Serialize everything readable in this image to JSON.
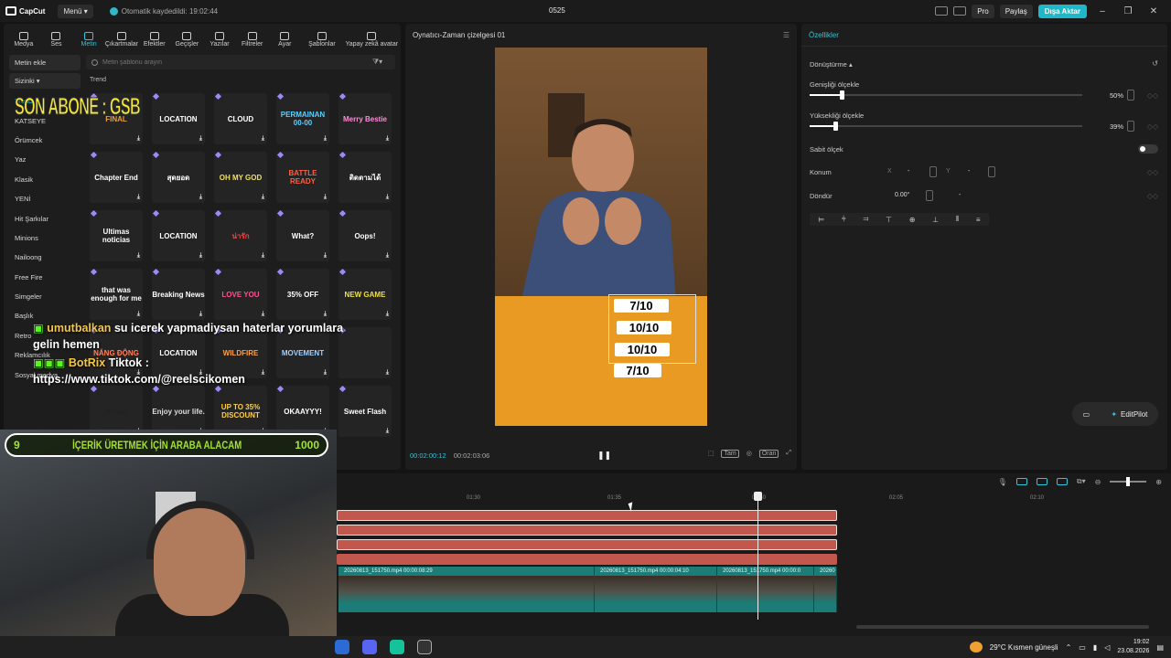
{
  "titlebar": {
    "app_name": "CapCut",
    "menu_label": "Menü",
    "autosave": "Otomatik kaydedildi: 19:02:44",
    "project_name": "0525",
    "pro_label": "Pro",
    "share_label": "Paylaş",
    "export_label": "Dışa Aktar"
  },
  "toolbar": {
    "items": [
      {
        "label": "Medya",
        "icon": "media-icon"
      },
      {
        "label": "Ses",
        "icon": "audio-icon"
      },
      {
        "label": "Metin",
        "icon": "text-icon"
      },
      {
        "label": "Çıkartmalar",
        "icon": "sticker-icon"
      },
      {
        "label": "Efektler",
        "icon": "effects-icon"
      },
      {
        "label": "Geçişler",
        "icon": "transition-icon"
      },
      {
        "label": "Yazılar",
        "icon": "captions-icon"
      },
      {
        "label": "Filtreler",
        "icon": "filter-icon"
      },
      {
        "label": "Ayar",
        "icon": "adjust-icon"
      },
      {
        "label": "Şablonlar",
        "icon": "templates-icon"
      },
      {
        "label": "Yapay zekâ avatar",
        "icon": "avatar-icon"
      }
    ],
    "active": "Metin"
  },
  "sidebar": {
    "add_text": "Metin ekle",
    "mine": "Sizinki",
    "items": [
      "Trend",
      "KATSEYE",
      "Örümcek",
      "Yaz",
      "Klasik",
      "YENİ",
      "Hit Şarkılar",
      "Minions",
      "Nailoong",
      "Free Fire",
      "Simgeler",
      "Başlık",
      "Retro",
      "Reklamcılık",
      "Sosyal medya"
    ],
    "selected": "Trend"
  },
  "search": {
    "placeholder": "Metin şablonu arayın"
  },
  "section_label": "Trend",
  "tiles": [
    {
      "text": "FINAL",
      "color": "#f0a030"
    },
    {
      "text": "LOCATION",
      "color": "#ffffff"
    },
    {
      "text": "CLOUD",
      "color": "#ffffff"
    },
    {
      "text": "PERMAINAN 00-00",
      "color": "#5ad0ff"
    },
    {
      "text": "Merry Bestie",
      "color": "#ff8ad8"
    },
    {
      "text": "Chapter End",
      "color": "#ffffff"
    },
    {
      "text": "สุดยอด",
      "color": "#ffffff"
    },
    {
      "text": "OH MY GOD",
      "color": "#f0e060"
    },
    {
      "text": "BATTLE READY",
      "color": "#ff6040"
    },
    {
      "text": "ติดตามได้",
      "color": "#ffffff"
    },
    {
      "text": "Ultimas noticias",
      "color": "#ffffff"
    },
    {
      "text": "LOCATION",
      "color": "#ffffff"
    },
    {
      "text": "น่ารัก",
      "color": "#ff4040"
    },
    {
      "text": "What?",
      "color": "#ffffff"
    },
    {
      "text": "Oops!",
      "color": "#ffffff"
    },
    {
      "text": "that was enough for me",
      "color": "#ffffff"
    },
    {
      "text": "Breaking News",
      "color": "#ffffff"
    },
    {
      "text": "LOVE YOU",
      "color": "#ff5090"
    },
    {
      "text": "35% OFF",
      "color": "#ffffff"
    },
    {
      "text": "NEW GAME",
      "color": "#f0e040"
    },
    {
      "text": "NĂNG ĐỘNG",
      "color": "#ff8060"
    },
    {
      "text": "LOCATION",
      "color": "#ffffff"
    },
    {
      "text": "WILDFIRE",
      "color": "#ffa040"
    },
    {
      "text": "MOVEMENT",
      "color": "#a0d0ff"
    },
    {
      "text": "",
      "color": "#ffffff"
    },
    {
      "text": "Đi nào",
      "color": "#222222"
    },
    {
      "text": "Enjoy your life.",
      "color": "#dddddd"
    },
    {
      "text": "UP TO 35% DISCOUNT",
      "color": "#ffd040"
    },
    {
      "text": "OKAAYYY!",
      "color": "#ffffff"
    },
    {
      "text": "Sweet Flash",
      "color": "#ffffff"
    }
  ],
  "player": {
    "title": "Oynatıcı-Zaman çizelgesi 01",
    "current_time": "00:02:00:12",
    "total_time": "00:02:03:06",
    "scores": [
      "7/10",
      "10/10",
      "10/10",
      "7/10"
    ],
    "tools": [
      "Tam",
      "Oran"
    ]
  },
  "properties": {
    "title": "Özellikler",
    "section": "Dönüştürme",
    "width_label": "Genişliği ölçekle",
    "width_value": "50%",
    "width_pct": 50,
    "height_label": "Yüksekliği ölçekle",
    "height_value": "39%",
    "height_pct": 39,
    "uniform_label": "Sabit ölçek",
    "position_label": "Konum",
    "x_label": "X",
    "x_value": "-",
    "y_label": "Y",
    "y_value": "-",
    "rotate_label": "Döndür",
    "rotate_value": "0.00°",
    "rotate_extra": "-",
    "editpilot_label": "EditPilot"
  },
  "timeline": {
    "ticks": [
      "01:30",
      "01:35",
      "01:40",
      "02:05",
      "02:10"
    ],
    "clips": [
      {
        "label": "20260813_151750.mp4   00:00:08:29"
      },
      {
        "label": "20260813_151750.mp4   00:00:04:10"
      },
      {
        "label": "20260813_151750.mp4   00:00:0"
      },
      {
        "label": "20260"
      }
    ]
  },
  "taskbar": {
    "weather": "29°C  Kısmen güneşli",
    "time": "19:02",
    "date": "23.08.2026"
  },
  "overlays": {
    "sub_banner": "SON ABONE : GSB",
    "chat_user1": "umutbalkan",
    "chat_msg1": "su icerek yapmadiysan haterlar yorumlara gelin hemen",
    "chat_user2": "BotRix",
    "chat_msg2": "Tiktok : https://www.tiktok.com/@reelscikomen",
    "goal_left": "9",
    "goal_text": "İÇERİK ÜRETMEK İÇİN ARABA ALACAM",
    "goal_right": "1000"
  }
}
